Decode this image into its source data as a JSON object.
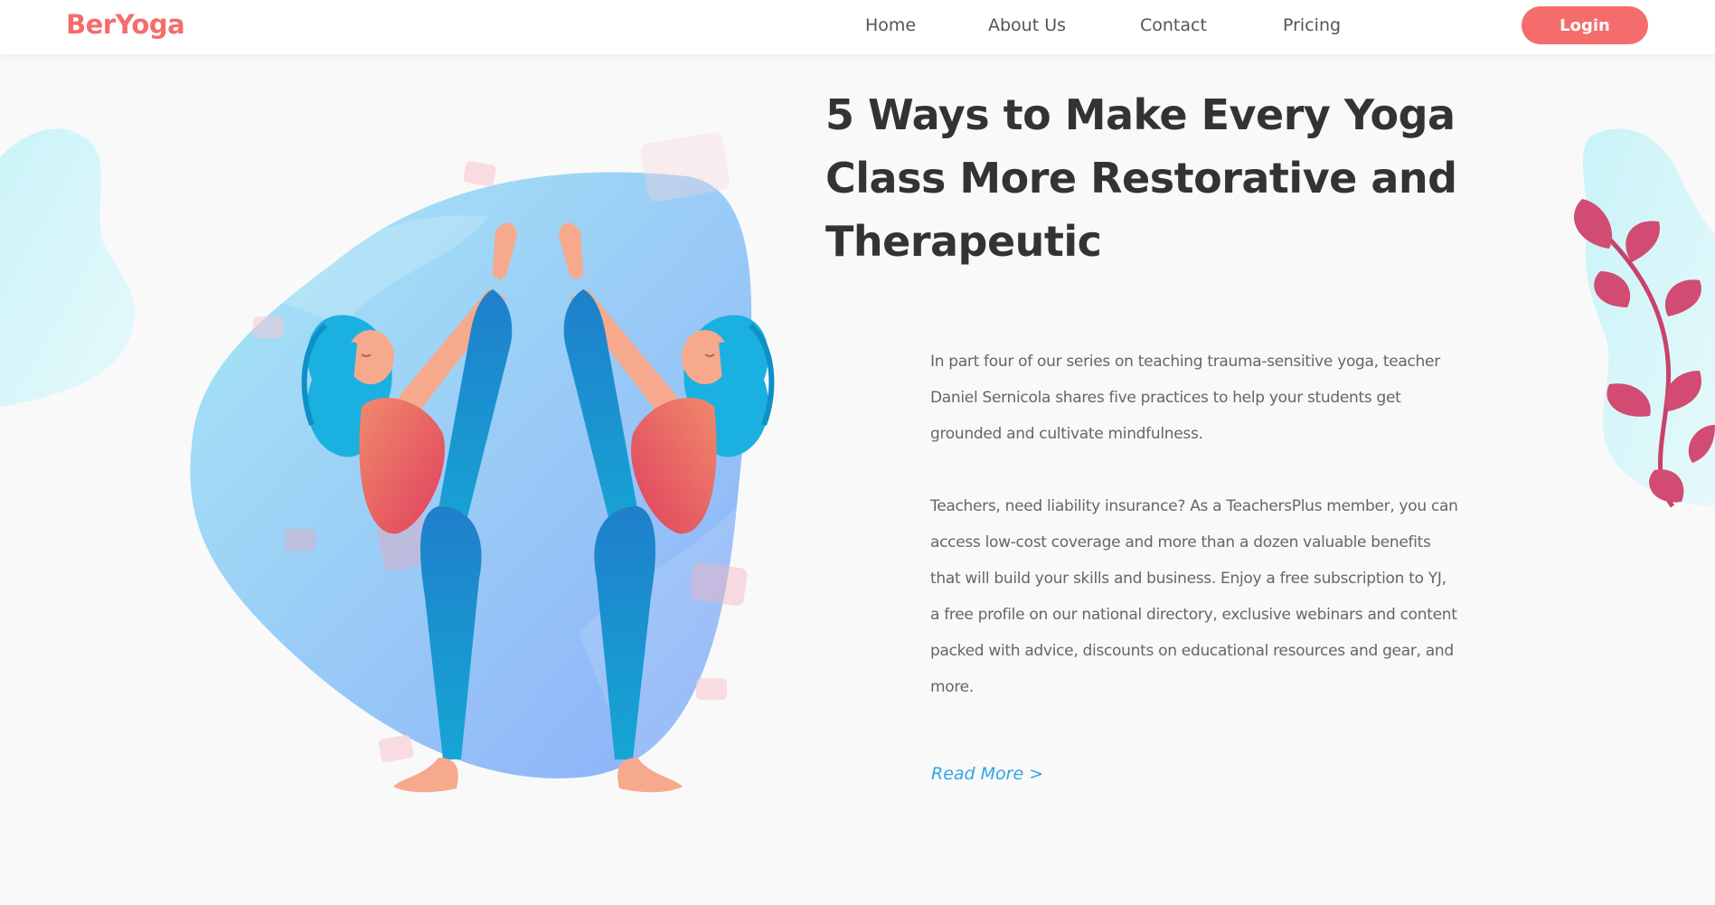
{
  "brand": {
    "logo": "BerYoga",
    "accent_color": "#f56c6c",
    "link_color": "#2fa6e3"
  },
  "nav": {
    "items": [
      {
        "label": "Home"
      },
      {
        "label": "About Us"
      },
      {
        "label": "Contact"
      },
      {
        "label": "Pricing"
      }
    ],
    "login_label": "Login"
  },
  "article": {
    "title": "5 Ways to Make Every Yoga Class More Restorative and Therapeutic",
    "paragraph_1": "In part four of our series on teaching trauma-sensitive yoga, teacher Daniel Sernicola shares five practices to help your students get grounded and cultivate mindfulness.",
    "paragraph_2": "Teachers, need liability insurance? As a TeachersPlus member, you can access low-cost coverage and more than a dozen valuable benefits that will build your skills and business. Enjoy a free subscription to YJ, a free profile on our national directory, exclusive webinars and content packed with advice, discounts on educational resources and gear, and more.",
    "read_more": "Read More >"
  },
  "illustration": {
    "subject": "two mirrored women in standing split yoga pose",
    "icons": [
      "yoga-illustration",
      "leaf-branch-icon",
      "blob-decoration"
    ]
  }
}
